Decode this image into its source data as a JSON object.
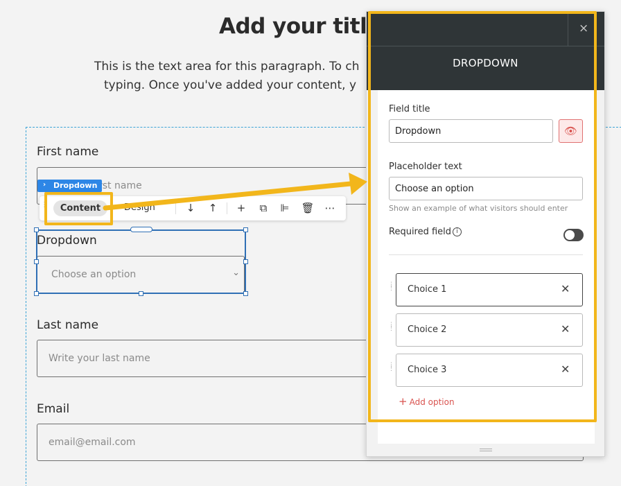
{
  "page": {
    "title": "Add your title",
    "paragraph_line1": "This is the text area for this paragraph. To ch",
    "paragraph_line2": "typing. Once you've added your content, y"
  },
  "form": {
    "first_name": {
      "label": "First name",
      "placeholder": "rst name"
    },
    "dropdown": {
      "label": "Dropdown",
      "placeholder": "Choose an option"
    },
    "last_name": {
      "label": "Last name",
      "placeholder": "Write your last name"
    },
    "email": {
      "label": "Email",
      "placeholder": "email@email.com"
    }
  },
  "element_tag": {
    "label": "Dropdown"
  },
  "toolbar": {
    "content_tab": "Content",
    "design_tab": "Design",
    "icons": [
      "move-down-icon",
      "move-up-icon",
      "add-icon",
      "duplicate-icon",
      "align-icon",
      "delete-icon",
      "more-icon"
    ]
  },
  "panel": {
    "title": "DROPDOWN",
    "close": "×",
    "field_title_label": "Field title",
    "field_title_value": "Dropdown",
    "placeholder_label": "Placeholder text",
    "placeholder_value": "Choose an option",
    "helper_text": "Show an example of what visitors should enter",
    "required_label": "Required field",
    "required_on": false,
    "choices": [
      {
        "label": "Choice 1"
      },
      {
        "label": "Choice 2"
      },
      {
        "label": "Choice 3"
      }
    ],
    "add_option": "Add option"
  },
  "colors": {
    "highlight": "#f2b61b",
    "panel_header": "#2f3537",
    "accent_red": "#d9534f",
    "selection_blue": "#2f6fb5",
    "tag_blue": "#2d86e6"
  }
}
